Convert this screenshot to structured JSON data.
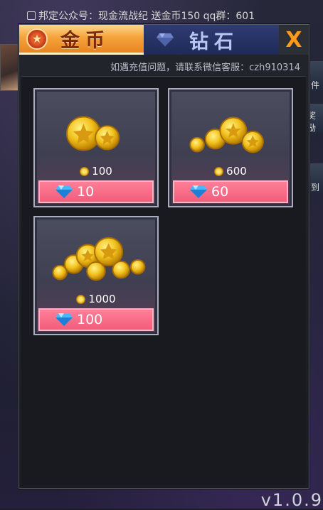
{
  "marquee": {
    "text": "邦定公众号：现金流战纪 送金币150 qq群：601"
  },
  "side_buttons": [
    "件",
    "奖励",
    "到"
  ],
  "version": "v1.0.9",
  "tabs": {
    "gold_label": "金币",
    "diamond_label": "钻石",
    "close_label": "X"
  },
  "notice": "如遇充值问题，请联系微信客服：czh910314",
  "packs": [
    {
      "amount": "100",
      "price": "10"
    },
    {
      "amount": "600",
      "price": "60"
    },
    {
      "amount": "1000",
      "price": "100"
    }
  ],
  "colors": {
    "accent": "#f25d7b",
    "gold": "#f5a33b",
    "close": "#ff9a1a"
  },
  "icons": {
    "coin": "coin-icon",
    "diamond": "diamond-icon",
    "close": "close-icon"
  }
}
